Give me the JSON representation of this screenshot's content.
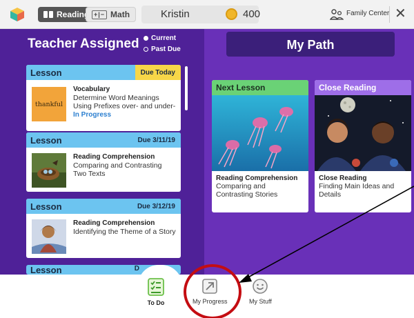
{
  "header": {
    "tabs": [
      {
        "label": "Reading",
        "active": true
      },
      {
        "label": "Math",
        "active": false
      }
    ],
    "user_name": "Kristin",
    "coins": "400",
    "family_center_label": "Family Center"
  },
  "teacher_assigned": {
    "title": "Teacher Assigned",
    "filters": [
      "Current",
      "Past Due"
    ],
    "selected_filter": "Current",
    "lessons": [
      {
        "type": "Lesson",
        "due": "Due Today",
        "thumb_word": "thankful",
        "title": "Vocabulary",
        "description": "Determine Word Meanings Using Prefixes over- and under-",
        "status": "In Progress"
      },
      {
        "type": "Lesson",
        "due": "Due 3/11/19",
        "title": "Reading Comprehension",
        "description": "Comparing and Contrasting Two Texts"
      },
      {
        "type": "Lesson",
        "due": "Due 3/12/19",
        "title": "Reading Comprehension",
        "description": "Identifying the Theme of a Story"
      },
      {
        "type": "Lesson",
        "due": "D"
      }
    ]
  },
  "my_path": {
    "title": "My Path",
    "cards": [
      {
        "header": "Next Lesson",
        "title": "Reading Comprehension",
        "description": "Comparing and Contrasting Stories"
      },
      {
        "header": "Close Reading",
        "title": "Close Reading",
        "description": "Finding Main Ideas and Details"
      }
    ]
  },
  "bottom_nav": {
    "items": [
      {
        "label": "To Do",
        "icon": "checklist-icon",
        "active": true
      },
      {
        "label": "My Progress",
        "icon": "progress-arrow-icon",
        "active": false
      },
      {
        "label": "My Stuff",
        "icon": "smiley-icon",
        "active": false
      }
    ]
  },
  "colors": {
    "background_purple": "#5d2ca8",
    "lesson_header_blue": "#6cc4f0",
    "due_today_yellow": "#f7d648",
    "next_lesson_green": "#6ad276",
    "close_reading_purple": "#9e6ee8",
    "annotation_red": "#c40d12"
  }
}
